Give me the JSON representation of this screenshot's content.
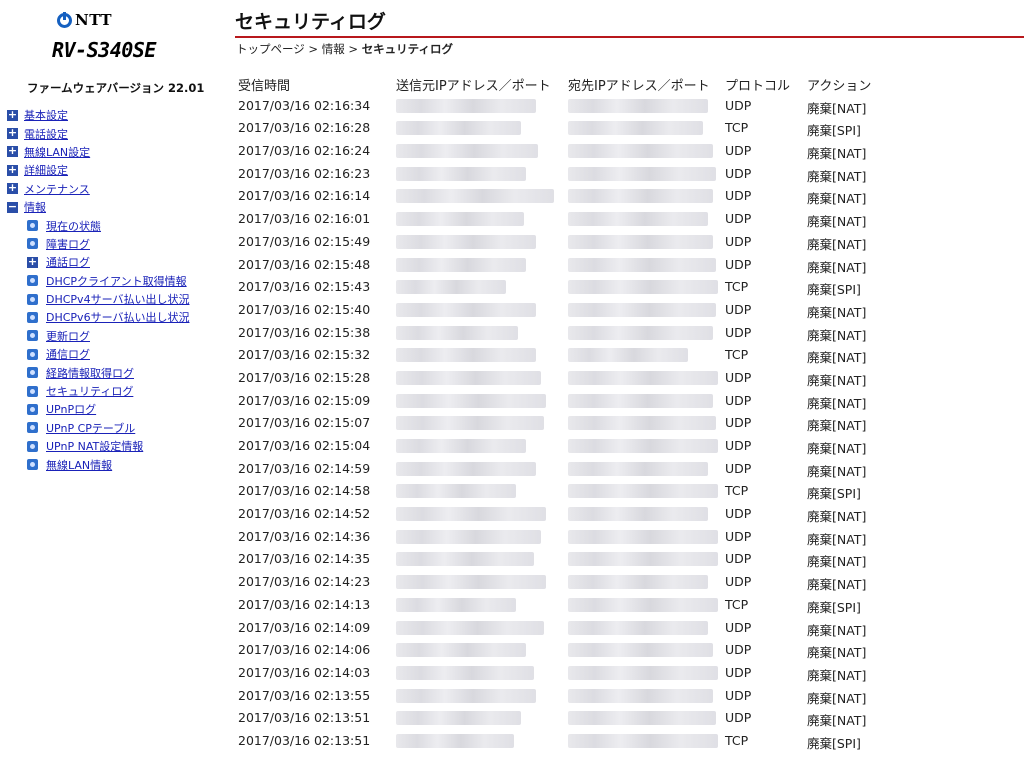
{
  "sidebar": {
    "brand": "NTT",
    "model": "RV-S340SE",
    "firmware": "ファームウェアバージョン 22.01",
    "menu": [
      {
        "label": "基本設定",
        "toggle": "+",
        "level": 0
      },
      {
        "label": "電話設定",
        "toggle": "+",
        "level": 0
      },
      {
        "label": "無線LAN設定",
        "toggle": "+",
        "level": 0
      },
      {
        "label": "詳細設定",
        "toggle": "+",
        "level": 0
      },
      {
        "label": "メンテナンス",
        "toggle": "+",
        "level": 0
      },
      {
        "label": "情報",
        "toggle": "−",
        "level": 0
      },
      {
        "label": "現在の状態",
        "toggle": "",
        "level": 1
      },
      {
        "label": "障害ログ",
        "toggle": "",
        "level": 1
      },
      {
        "label": "通話ログ",
        "toggle": "+",
        "level": 1
      },
      {
        "label": "DHCPクライアント取得情報",
        "toggle": "",
        "level": 1
      },
      {
        "label": "DHCPv4サーバ払い出し状況",
        "toggle": "",
        "level": 1
      },
      {
        "label": "DHCPv6サーバ払い出し状況",
        "toggle": "",
        "level": 1
      },
      {
        "label": "更新ログ",
        "toggle": "",
        "level": 1
      },
      {
        "label": "通信ログ",
        "toggle": "",
        "level": 1
      },
      {
        "label": "経路情報取得ログ",
        "toggle": "",
        "level": 1
      },
      {
        "label": "セキュリティログ",
        "toggle": "",
        "level": 1
      },
      {
        "label": "UPnPログ",
        "toggle": "",
        "level": 1
      },
      {
        "label": "UPnP CPテーブル",
        "toggle": "",
        "level": 1
      },
      {
        "label": "UPnP NAT設定情報",
        "toggle": "",
        "level": 1
      },
      {
        "label": "無線LAN情報",
        "toggle": "",
        "level": 1
      }
    ]
  },
  "main": {
    "title": "セキュリティログ",
    "breadcrumb": {
      "home": "トップページ",
      "sep1": " > ",
      "info": "情報",
      "sep2": " > ",
      "current": "セキュリティログ"
    },
    "columns": [
      "受信時間",
      "送信元IPアドレス／ポート",
      "宛先IPアドレス／ポート",
      "プロトコル",
      "アクション"
    ],
    "rows": [
      {
        "time": "2017/03/16 02:16:34",
        "protocol": "UDP",
        "action": "廃棄[NAT]"
      },
      {
        "time": "2017/03/16 02:16:28",
        "protocol": "TCP",
        "action": "廃棄[SPI]"
      },
      {
        "time": "2017/03/16 02:16:24",
        "protocol": "UDP",
        "action": "廃棄[NAT]"
      },
      {
        "time": "2017/03/16 02:16:23",
        "protocol": "UDP",
        "action": "廃棄[NAT]"
      },
      {
        "time": "2017/03/16 02:16:14",
        "protocol": "UDP",
        "action": "廃棄[NAT]"
      },
      {
        "time": "2017/03/16 02:16:01",
        "protocol": "UDP",
        "action": "廃棄[NAT]"
      },
      {
        "time": "2017/03/16 02:15:49",
        "protocol": "UDP",
        "action": "廃棄[NAT]"
      },
      {
        "time": "2017/03/16 02:15:48",
        "protocol": "UDP",
        "action": "廃棄[NAT]"
      },
      {
        "time": "2017/03/16 02:15:43",
        "protocol": "TCP",
        "action": "廃棄[SPI]"
      },
      {
        "time": "2017/03/16 02:15:40",
        "protocol": "UDP",
        "action": "廃棄[NAT]"
      },
      {
        "time": "2017/03/16 02:15:38",
        "protocol": "UDP",
        "action": "廃棄[NAT]"
      },
      {
        "time": "2017/03/16 02:15:32",
        "protocol": "TCP",
        "action": "廃棄[NAT]"
      },
      {
        "time": "2017/03/16 02:15:28",
        "protocol": "UDP",
        "action": "廃棄[NAT]"
      },
      {
        "time": "2017/03/16 02:15:09",
        "protocol": "UDP",
        "action": "廃棄[NAT]"
      },
      {
        "time": "2017/03/16 02:15:07",
        "protocol": "UDP",
        "action": "廃棄[NAT]"
      },
      {
        "time": "2017/03/16 02:15:04",
        "protocol": "UDP",
        "action": "廃棄[NAT]"
      },
      {
        "time": "2017/03/16 02:14:59",
        "protocol": "UDP",
        "action": "廃棄[NAT]"
      },
      {
        "time": "2017/03/16 02:14:58",
        "protocol": "TCP",
        "action": "廃棄[SPI]"
      },
      {
        "time": "2017/03/16 02:14:52",
        "protocol": "UDP",
        "action": "廃棄[NAT]"
      },
      {
        "time": "2017/03/16 02:14:36",
        "protocol": "UDP",
        "action": "廃棄[NAT]"
      },
      {
        "time": "2017/03/16 02:14:35",
        "protocol": "UDP",
        "action": "廃棄[NAT]"
      },
      {
        "time": "2017/03/16 02:14:23",
        "protocol": "UDP",
        "action": "廃棄[NAT]"
      },
      {
        "time": "2017/03/16 02:14:13",
        "protocol": "TCP",
        "action": "廃棄[SPI]"
      },
      {
        "time": "2017/03/16 02:14:09",
        "protocol": "UDP",
        "action": "廃棄[NAT]"
      },
      {
        "time": "2017/03/16 02:14:06",
        "protocol": "UDP",
        "action": "廃棄[NAT]"
      },
      {
        "time": "2017/03/16 02:14:03",
        "protocol": "UDP",
        "action": "廃棄[NAT]"
      },
      {
        "time": "2017/03/16 02:13:55",
        "protocol": "UDP",
        "action": "廃棄[NAT]"
      },
      {
        "time": "2017/03/16 02:13:51",
        "protocol": "UDP",
        "action": "廃棄[NAT]"
      },
      {
        "time": "2017/03/16 02:13:51",
        "protocol": "TCP",
        "action": "廃棄[SPI]"
      }
    ]
  },
  "colors": {
    "accent_rule": "#b8181c",
    "link": "#1a22b8",
    "toggle_bg": "#2a4ea8"
  }
}
